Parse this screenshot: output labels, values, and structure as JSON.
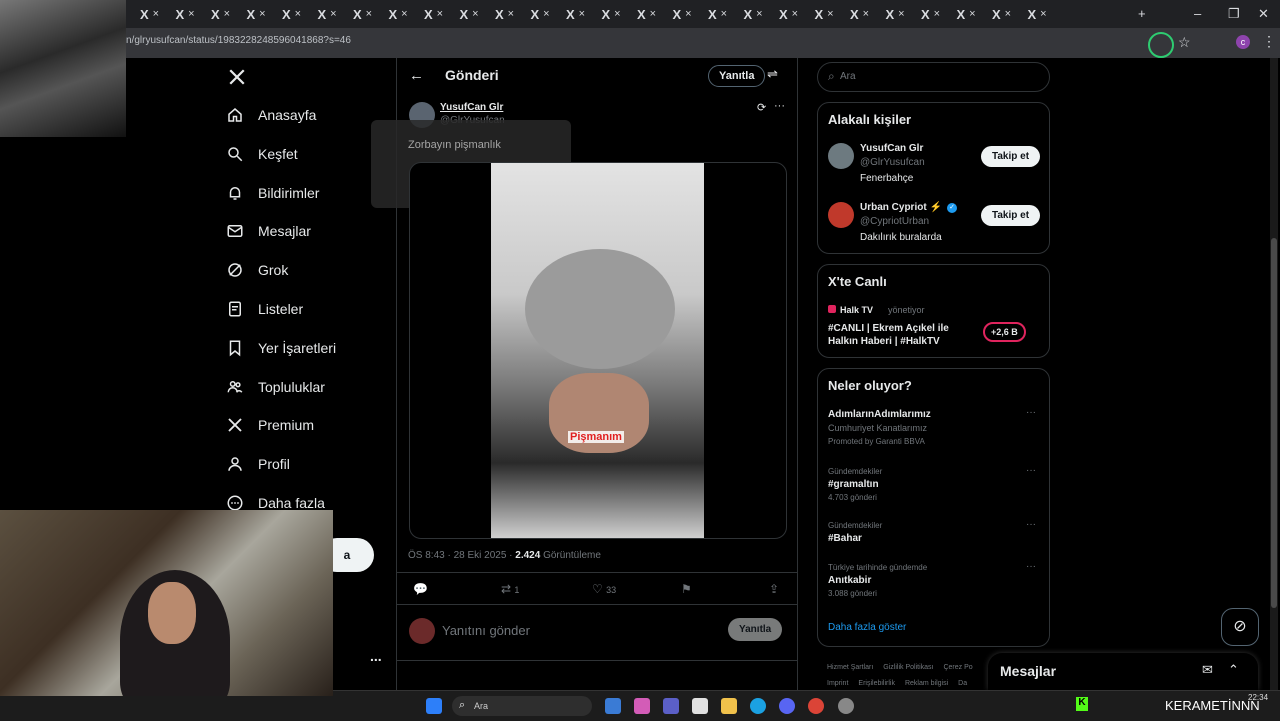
{
  "browser": {
    "url": "n/glryusufcan/status/1983228248596041868?s=46",
    "tab_glyph": "X",
    "new_tab": "+",
    "win_min": "–",
    "win_max": "❐",
    "win_close": "✕"
  },
  "nav": {
    "items": [
      {
        "label": "Anasayfa",
        "icon": "home-icon"
      },
      {
        "label": "Keşfet",
        "icon": "search-icon"
      },
      {
        "label": "Bildirimler",
        "icon": "bell-icon"
      },
      {
        "label": "Mesajlar",
        "icon": "mail-icon"
      },
      {
        "label": "Grok",
        "icon": "grok-icon"
      },
      {
        "label": "Listeler",
        "icon": "list-icon"
      },
      {
        "label": "Yer İşaretleri",
        "icon": "bookmark-icon"
      },
      {
        "label": "Topluluklar",
        "icon": "people-icon"
      },
      {
        "label": "Premium",
        "icon": "x-logo-icon"
      },
      {
        "label": "Profil",
        "icon": "user-icon"
      },
      {
        "label": "Daha fazla",
        "icon": "more-icon"
      }
    ],
    "post_button_partial": "a",
    "more_dots": "..."
  },
  "post": {
    "header_title": "Gönderi",
    "reply_button": "Yanıtla",
    "author_name": "YusufCan Glr",
    "author_handle": "@GlrYusufcan",
    "text": "Zorbayın pişmanlık",
    "video_caption": "Pişmanım",
    "time": "ÖS 8:43 · 28 Eki 2025 · ",
    "views": "2.424",
    "views_label": " Görüntüleme",
    "retweets": "1",
    "likes": "33",
    "reply_placeholder": "Yanıtını gönder",
    "reply_submit": "Yanıtla"
  },
  "right": {
    "search_placeholder": "Ara",
    "related_title": "Alakalı kişiler",
    "people": [
      {
        "name": "YusufCan Glr",
        "handle": "@GlrYusufcan",
        "bio": "Fenerbahçe",
        "follow": "Takip et"
      },
      {
        "name": "Urban Cypriot ⚡",
        "handle": "@CypriotUrban",
        "bio": "Dakılırık buralarda",
        "follow": "Takip et"
      }
    ],
    "live_title": "X'te Canlı",
    "live_host": "Halk TV",
    "live_role": "yönetiyor",
    "live_text": "#CANLI | Ekrem Açıkel ile Halkın Haberi | #HalkTV",
    "live_count": "+2,6 B",
    "trends_title": "Neler oluyor?",
    "trends": [
      {
        "context": "",
        "name": "AdımlarınAdımlarımız",
        "sub": "Cumhuriyet Kanatlarımız",
        "meta": "Promoted by Garanti BBVA"
      },
      {
        "context": "Gündemdekiler",
        "name": "#gramaltın",
        "sub": "",
        "meta": "4.703 gönderi"
      },
      {
        "context": "Gündemdekiler",
        "name": "#Bahar",
        "sub": "",
        "meta": ""
      },
      {
        "context": "Türkiye tarihinde gündemde",
        "name": "Anıtkabir",
        "sub": "",
        "meta": "3.088 gönderi"
      }
    ],
    "show_more": "Daha fazla göster",
    "footer": [
      "Hizmet Şartları",
      "Gizlilik Politikası",
      "Çerez Po",
      "Imprint",
      "Erişilebilirlik",
      "Reklam bilgisi",
      "Da"
    ],
    "messages_title": "Mesajlar"
  },
  "taskbar": {
    "search": "Ara",
    "time": "22:34",
    "stream_text": "KERAMETİNNN"
  },
  "colors": {
    "accent": "#1d9bf0",
    "bg": "#000000",
    "border": "#2f3336",
    "muted": "#71767b",
    "live_red": "#e0245e"
  }
}
